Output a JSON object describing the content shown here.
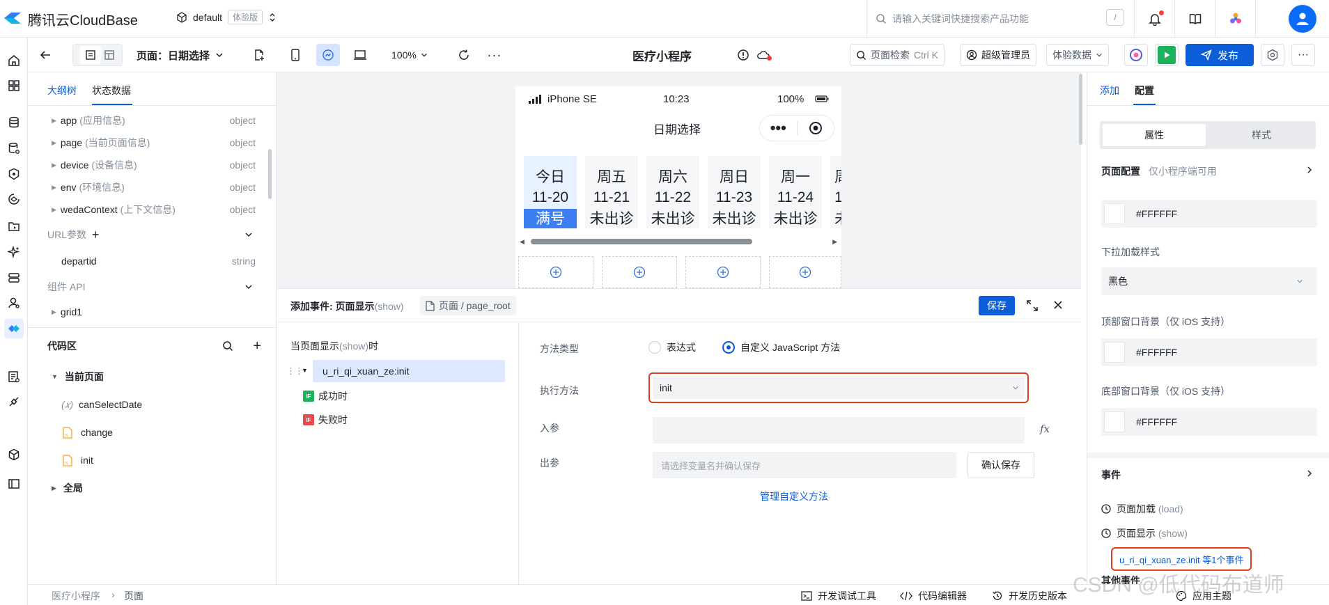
{
  "topbar": {
    "brand": "腾讯云CloudBase",
    "env_name": "default",
    "env_tag": "体验版",
    "search_placeholder": "请输入关键词快捷搜索产品功能",
    "search_shortcut": "/"
  },
  "toolbar": {
    "page_label": "页面：日期选择",
    "zoom": "100%",
    "app_title": "医疗小程序",
    "page_search": "页面检索",
    "page_search_shortcut": "Ctrl K",
    "role": "超级管理员",
    "data_mode": "体验数据",
    "publish": "发布"
  },
  "left_panel": {
    "tabs": [
      "大纲树",
      "状态数据"
    ],
    "vars": [
      {
        "name": "app",
        "desc": "(应用信息)",
        "type": "object"
      },
      {
        "name": "page",
        "desc": "(当前页面信息)",
        "type": "object"
      },
      {
        "name": "device",
        "desc": "(设备信息)",
        "type": "object"
      },
      {
        "name": "env",
        "desc": "(环境信息)",
        "type": "object"
      },
      {
        "name": "wedaContext",
        "desc": "(上下文信息)",
        "type": "object"
      }
    ],
    "url_params_label": "URL参数",
    "url_param": {
      "name": "departid",
      "type": "string"
    },
    "component_api_label": "组件 API",
    "component": "grid1",
    "code_area_label": "代码区",
    "current_page_label": "当前页面",
    "code_items": [
      "canSelectDate",
      "change",
      "init"
    ],
    "global_label": "全局"
  },
  "phone": {
    "carrier": "iPhone SE",
    "time": "10:23",
    "battery": "100%",
    "page_title": "日期选择",
    "days": [
      {
        "week": "今日",
        "date": "11-20",
        "status": "满号",
        "active": true
      },
      {
        "week": "周五",
        "date": "11-21",
        "status": "未出诊"
      },
      {
        "week": "周六",
        "date": "11-22",
        "status": "未出诊"
      },
      {
        "week": "周日",
        "date": "11-23",
        "status": "未出诊"
      },
      {
        "week": "周一",
        "date": "11-24",
        "status": "未出诊"
      }
    ],
    "partial_day": {
      "week": "周",
      "date": "1",
      "status": "未"
    }
  },
  "event_panel": {
    "title": "添加事件: 页面显示",
    "title_suffix": "(show)",
    "breadcrumb": "页面 / page_root",
    "save": "保存",
    "trigger_label": "当页面显示",
    "trigger_suffix": "(show)",
    "trigger_tail": "时",
    "action": "u_ri_qi_xuan_ze:init",
    "success": "成功时",
    "fail": "失败时",
    "method_type_label": "方法类型",
    "method_type_options": [
      "表达式",
      "自定义 JavaScript 方法"
    ],
    "exec_method_label": "执行方法",
    "exec_method_value": "init",
    "input_label": "入参",
    "output_label": "出参",
    "output_placeholder": "请选择变量名并确认保存",
    "confirm_save": "确认保存",
    "manage_link": "管理自定义方法",
    "fx": "fx"
  },
  "right_panel": {
    "tabs": [
      "添加",
      "配置"
    ],
    "segments": [
      "属性",
      "样式"
    ],
    "page_config_label": "页面配置",
    "page_config_hint": "仅小程序端可用",
    "bg_color": "#FFFFFF",
    "pull_style_label": "下拉加载样式",
    "pull_style_value": "黑色",
    "top_bg_label": "顶部窗口背景（仅 iOS 支持）",
    "top_bg_color": "#FFFFFF",
    "bottom_bg_label": "底部窗口背景（仅 iOS 支持）",
    "bottom_bg_color": "#FFFFFF",
    "events_label": "事件",
    "event_load": "页面加载",
    "event_load_suffix": "(load)",
    "event_show": "页面显示",
    "event_show_suffix": "(show)",
    "event_binding": "u_ri_qi_xuan_ze.init 等1个事件",
    "event_more": "其他事件"
  },
  "statusbar": {
    "crumbs": [
      "医疗小程序",
      "页面"
    ],
    "dev_tools": "开发调试工具",
    "code_editor": "代码编辑器",
    "history": "开发历史版本",
    "theme": "应用主题"
  },
  "watermark": "CSDN @低代码布道师",
  "colors": {
    "primary": "#0b5ed7",
    "highlight_red": "#d9401b",
    "selected_bg": "#dbe8ff",
    "run_green": "#1bb35a"
  }
}
